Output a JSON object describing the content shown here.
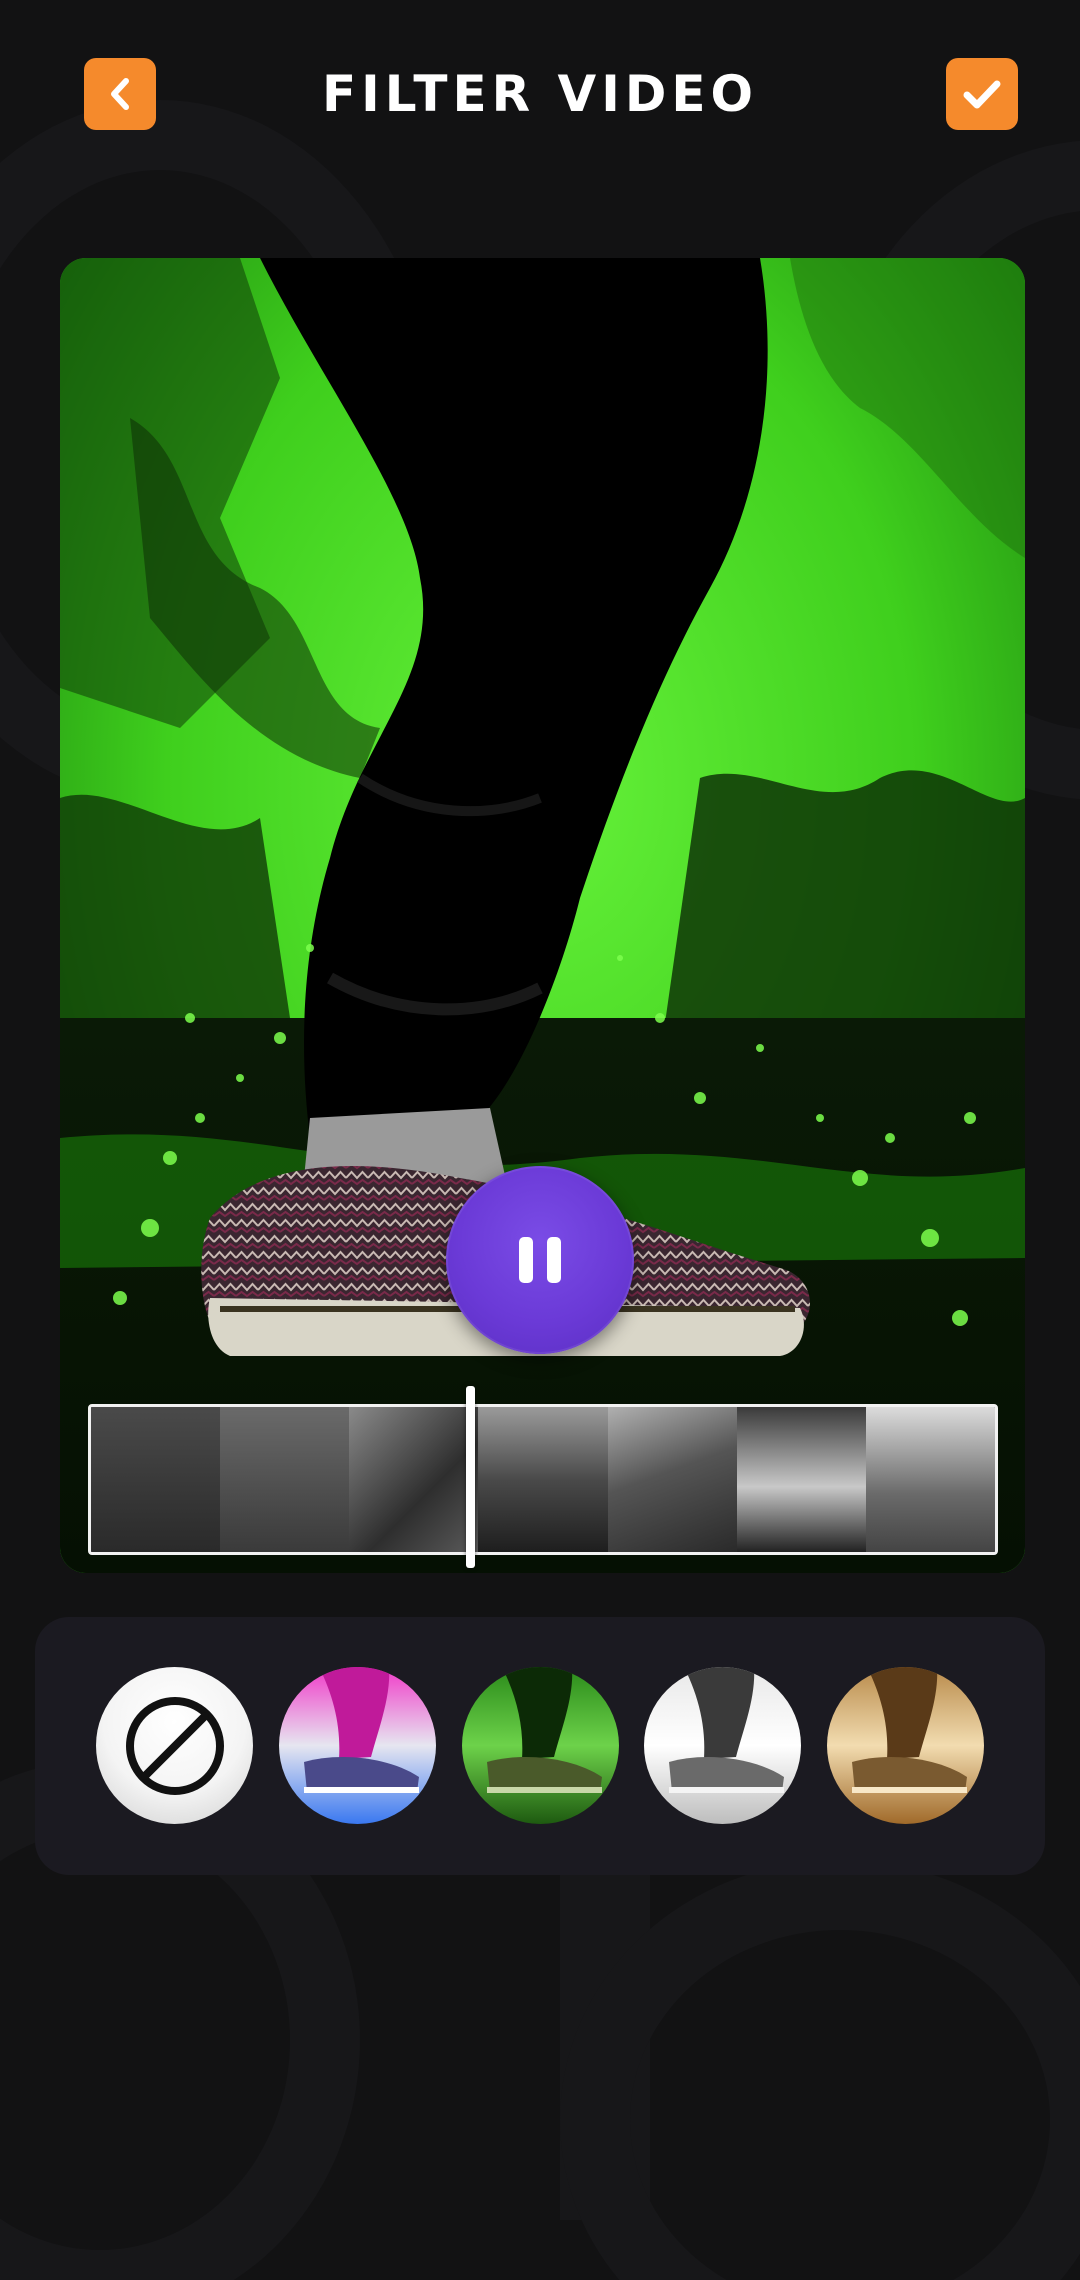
{
  "header": {
    "title": "FILTER VIDEO",
    "back_icon": "chevron-left-icon",
    "confirm_icon": "check-icon",
    "accent_color": "#F58A2C"
  },
  "player": {
    "state": "playing",
    "control_icon": "pause-icon",
    "control_color": "#6B3AD7",
    "active_filter": "green"
  },
  "timeline": {
    "frame_count": 7,
    "playhead_fraction": 0.42
  },
  "filters": [
    {
      "id": "none",
      "icon": "no-filter-icon",
      "selected": false
    },
    {
      "id": "pink-blue",
      "icon": "filter-thumbnail",
      "selected": false
    },
    {
      "id": "green",
      "icon": "filter-thumbnail",
      "selected": true
    },
    {
      "id": "black-white",
      "icon": "filter-thumbnail",
      "selected": false
    },
    {
      "id": "sepia",
      "icon": "filter-thumbnail",
      "selected": false
    }
  ],
  "colors": {
    "background": "#121213",
    "tray": "#1B1A21",
    "green_filter": "#3FD11C"
  }
}
